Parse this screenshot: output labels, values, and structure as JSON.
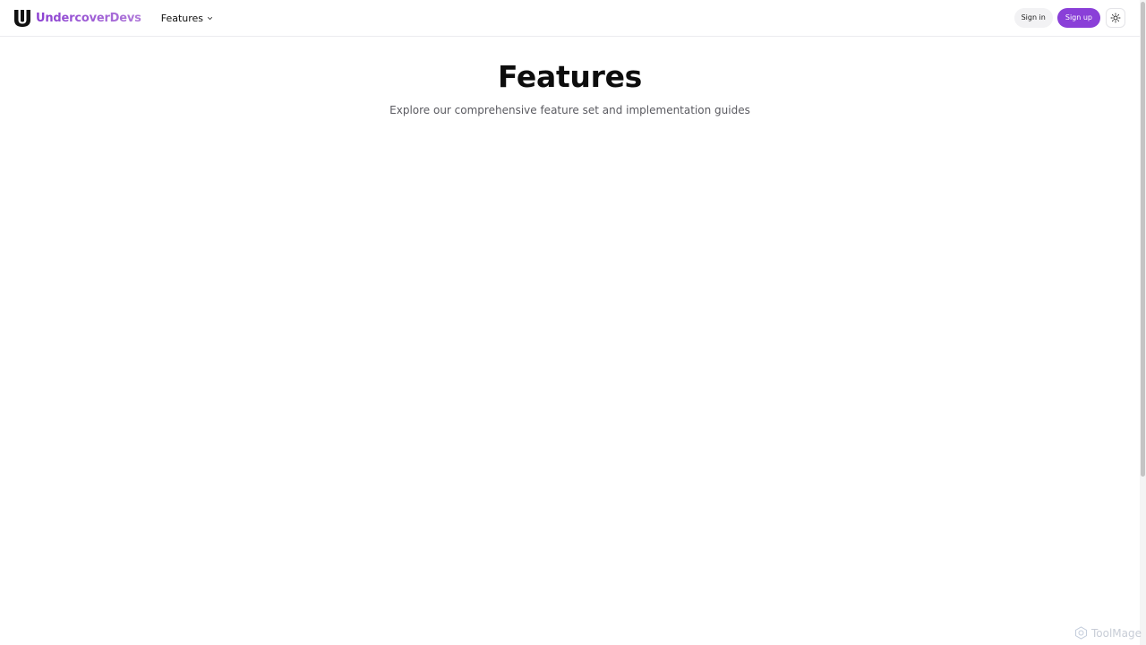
{
  "header": {
    "brand_name": "UndercoverDevs",
    "nav_features_label": "Features",
    "signin_label": "Sign in",
    "signup_label": "Sign up"
  },
  "hero": {
    "title": "Features",
    "subtitle": "Explore our comprehensive feature set and implementation guides"
  },
  "watermark": {
    "text": "ToolMage"
  },
  "colors": {
    "brand_purple": "#8a3fd8",
    "border": "#ececef",
    "muted_text": "#5a5a60"
  },
  "icons": {
    "brand": "brand-logo-icon",
    "features_dropdown": "chevron-down-icon",
    "theme_toggle": "sun-icon",
    "watermark": "watermark-logo-icon"
  }
}
